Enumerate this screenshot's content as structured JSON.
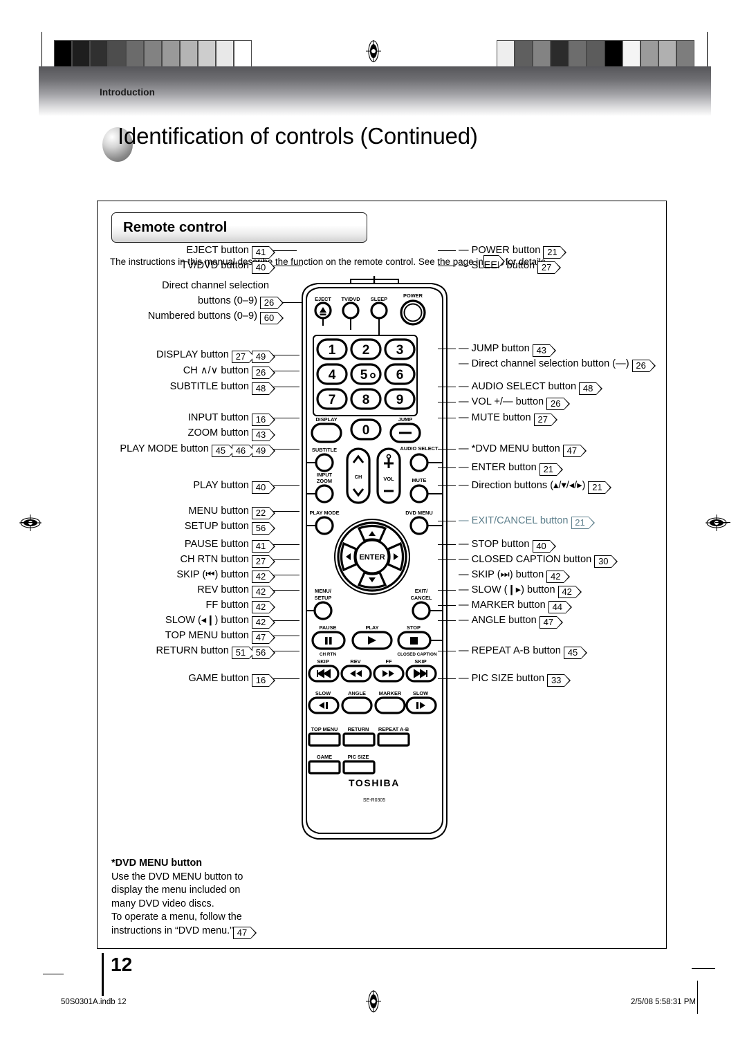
{
  "page": {
    "section_label": "Introduction",
    "title": "Identification of controls (Continued)",
    "number": "12"
  },
  "section": {
    "heading": "Remote control",
    "intro_prefix": "The instructions in this manual describe the function on the remote control. See the page in",
    "intro_suffix": "for details."
  },
  "labels_left": [
    {
      "text": "EJECT button",
      "refs": [
        "41"
      ]
    },
    {
      "text": "TV/DVD button",
      "refs": [
        "40"
      ]
    },
    {
      "text": "Direct channel selection",
      "refs": []
    },
    {
      "text": "buttons (0–9)",
      "refs": [
        "26"
      ]
    },
    {
      "text": "Numbered buttons (0–9)",
      "refs": [
        "60"
      ]
    },
    {
      "text": "DISPLAY button",
      "refs": [
        "27",
        "49"
      ]
    },
    {
      "text": "CH ∧/∨ button",
      "refs": [
        "26"
      ]
    },
    {
      "text": "SUBTITLE button",
      "refs": [
        "48"
      ]
    },
    {
      "text": "INPUT button",
      "refs": [
        "16"
      ]
    },
    {
      "text": "ZOOM button",
      "refs": [
        "43"
      ]
    },
    {
      "text": "PLAY MODE button",
      "refs": [
        "45",
        "46",
        "49"
      ]
    },
    {
      "text": "PLAY button",
      "refs": [
        "40"
      ]
    },
    {
      "text": "MENU button",
      "refs": [
        "22"
      ]
    },
    {
      "text": "SETUP button",
      "refs": [
        "56"
      ]
    },
    {
      "text": "PAUSE button",
      "refs": [
        "41"
      ]
    },
    {
      "text": "CH RTN button",
      "refs": [
        "27"
      ]
    },
    {
      "text": "SKIP (⏮) button",
      "refs": [
        "42"
      ]
    },
    {
      "text": "REV button",
      "refs": [
        "42"
      ]
    },
    {
      "text": "FF button",
      "refs": [
        "42"
      ]
    },
    {
      "text": "SLOW (◂❙) button",
      "refs": [
        "42"
      ]
    },
    {
      "text": "TOP MENU button",
      "refs": [
        "47"
      ]
    },
    {
      "text": "RETURN button",
      "refs": [
        "51",
        "56"
      ]
    },
    {
      "text": "GAME button",
      "refs": [
        "16"
      ]
    }
  ],
  "labels_right": [
    {
      "text": "POWER button",
      "refs": [
        "21"
      ]
    },
    {
      "text": "SLEEP button",
      "refs": [
        "27"
      ]
    },
    {
      "text": "JUMP button",
      "refs": [
        "43"
      ]
    },
    {
      "text": "Direct channel selection button (—)",
      "refs": [
        "26"
      ]
    },
    {
      "text": "AUDIO SELECT button",
      "refs": [
        "48"
      ]
    },
    {
      "text": "VOL +/— button",
      "refs": [
        "26"
      ]
    },
    {
      "text": "MUTE button",
      "refs": [
        "27"
      ]
    },
    {
      "text": "*DVD MENU button",
      "refs": [
        "47"
      ]
    },
    {
      "text": "ENTER button",
      "refs": [
        "21"
      ]
    },
    {
      "text": "Direction buttons (▴/▾/◂/▸)",
      "refs": [
        "21"
      ]
    },
    {
      "text": "EXIT/CANCEL button",
      "refs": [
        "21"
      ],
      "accent": true
    },
    {
      "text": "STOP button",
      "refs": [
        "40"
      ]
    },
    {
      "text": "CLOSED CAPTION button",
      "refs": [
        "30"
      ]
    },
    {
      "text": "SKIP (⏭) button",
      "refs": [
        "42"
      ]
    },
    {
      "text": "SLOW (❙▸) button",
      "refs": [
        "42"
      ]
    },
    {
      "text": "MARKER button",
      "refs": [
        "44"
      ]
    },
    {
      "text": "ANGLE button",
      "refs": [
        "47"
      ]
    },
    {
      "text": "REPEAT A-B button",
      "refs": [
        "45"
      ]
    },
    {
      "text": "PIC SIZE button",
      "refs": [
        "33"
      ]
    }
  ],
  "remote": {
    "brand": "TOSHIBA",
    "model": "SE-R0305",
    "top_buttons": [
      "EJECT",
      "TV/DVD",
      "SLEEP",
      "POWER"
    ],
    "keypad": [
      "1",
      "2",
      "3",
      "4",
      "5",
      "6",
      "7",
      "8",
      "9",
      "0"
    ],
    "keypad_row4": [
      "DISPLAY",
      "0",
      "JUMP"
    ],
    "row_subtitle": [
      "SUBTITLE",
      "CH",
      "VOL",
      "AUDIO SELECT"
    ],
    "row_input": [
      "INPUT",
      "ZOOM",
      "MUTE"
    ],
    "row_playmode": [
      "PLAY MODE",
      "DVD MENU"
    ],
    "dpad_center": "ENTER",
    "row_menu": [
      "MENU",
      "SETUP",
      "EXIT/",
      "CANCEL"
    ],
    "row_transport1": [
      "PAUSE",
      "PLAY",
      "STOP"
    ],
    "row_transport1_sub": [
      "CH RTN",
      "CLOSED CAPTION"
    ],
    "row_transport2": [
      "SKIP",
      "REV",
      "FF",
      "SKIP"
    ],
    "row_transport3": [
      "SLOW",
      "ANGLE",
      "MARKER",
      "SLOW"
    ],
    "row_keys1": [
      "TOP MENU",
      "RETURN",
      "REPEAT A-B"
    ],
    "row_keys2": [
      "GAME",
      "PIC SIZE"
    ]
  },
  "footnote": {
    "title": "*DVD MENU button",
    "line1": "Use the DVD MENU button to",
    "line2": "display the menu included on",
    "line3": "many DVD video discs.",
    "line4": "To operate a menu, follow the",
    "line5": "instructions in “DVD menu.”",
    "ref": "47"
  },
  "footer": {
    "file": "50S0301A.indb   12",
    "timestamp": "2/5/08   5:58:31 PM"
  },
  "registration": {
    "left_patches": [
      "#000000",
      "#1e1e1e",
      "#303030",
      "#4d4d4d",
      "#6b6b6b",
      "#828282",
      "#999999",
      "#b4b4b4",
      "#cdcdcd",
      "#e8e8e8",
      "#ffffff"
    ],
    "right_patches": [
      "#eeeeee",
      "#5f5f5f",
      "#838383",
      "#2b2b2b",
      "#6d6d6d",
      "#5c5c5c",
      "#000000",
      "#f4f4f4",
      "#9b9b9b",
      "#b0b0b0",
      "#7d7d7d"
    ]
  }
}
